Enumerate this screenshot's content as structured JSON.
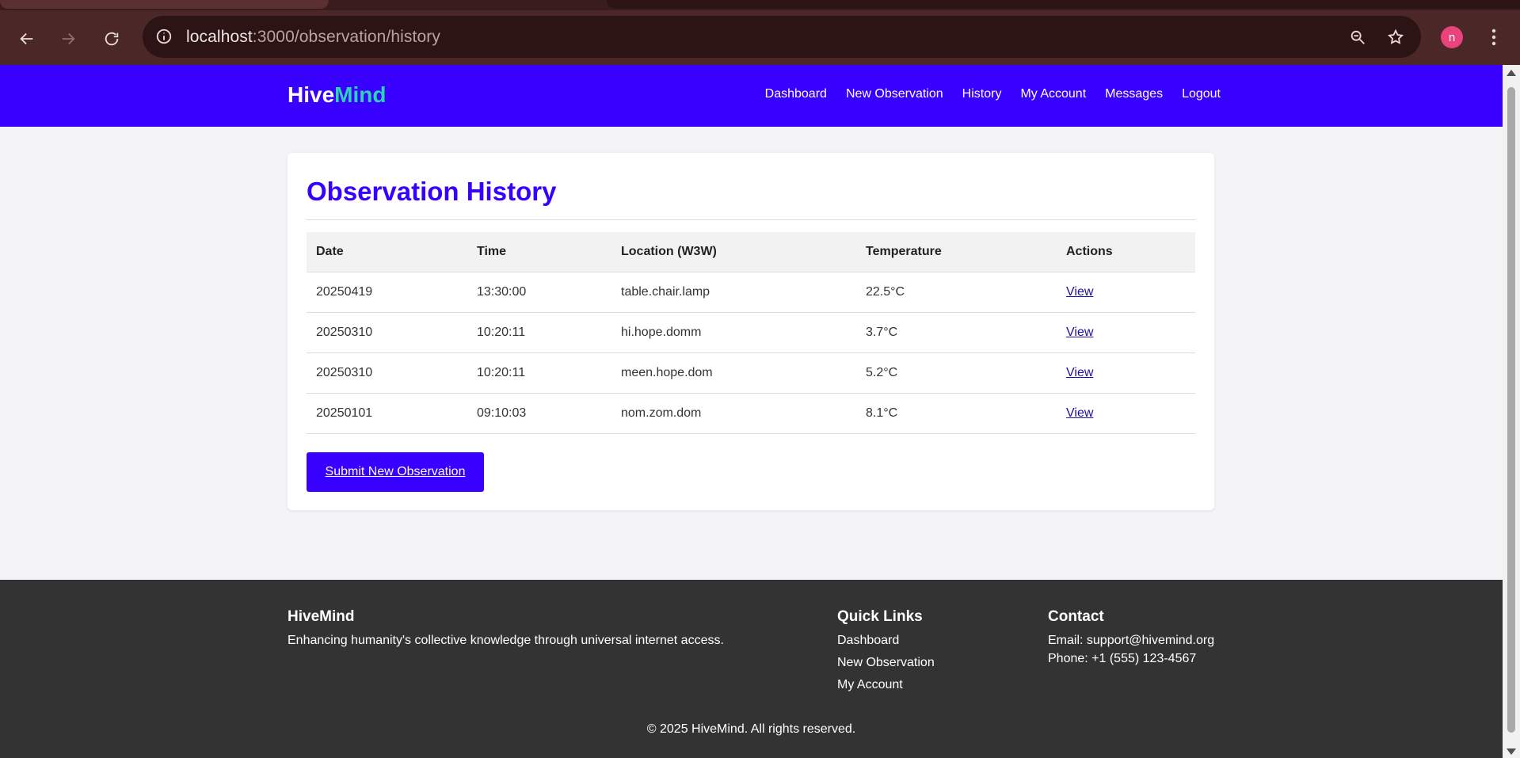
{
  "browser": {
    "url_host": "localhost",
    "url_path": ":3000/observation/history",
    "profile_initial": "n"
  },
  "header": {
    "logo_main": "Hive",
    "logo_accent": "Mind",
    "nav": [
      "Dashboard",
      "New Observation",
      "History",
      "My Account",
      "Messages",
      "Logout"
    ]
  },
  "main": {
    "title": "Observation History",
    "columns": [
      "Date",
      "Time",
      "Location (W3W)",
      "Temperature",
      "Actions"
    ],
    "rows": [
      {
        "date": "20250419",
        "time": "13:30:00",
        "location": "table.chair.lamp",
        "temperature": "22.5°C",
        "action": "View"
      },
      {
        "date": "20250310",
        "time": "10:20:11",
        "location": "hi.hope.domm",
        "temperature": "3.7°C",
        "action": "View"
      },
      {
        "date": "20250310",
        "time": "10:20:11",
        "location": "meen.hope.dom",
        "temperature": "5.2°C",
        "action": "View"
      },
      {
        "date": "20250101",
        "time": "09:10:03",
        "location": "nom.zom.dom",
        "temperature": "8.1°C",
        "action": "View"
      }
    ],
    "submit_label": "Submit New Observation"
  },
  "footer": {
    "brand_title": "HiveMind",
    "brand_text": "Enhancing humanity's collective knowledge through universal internet access.",
    "links_title": "Quick Links",
    "links": [
      "Dashboard",
      "New Observation",
      "My Account"
    ],
    "contact_title": "Contact",
    "email": "Email: support@hivemind.org",
    "phone": "Phone: +1 (555) 123-4567",
    "copyright": "© 2025 HiveMind. All rights reserved."
  },
  "colors": {
    "header_bg": "#3700ff",
    "logo_accent": "#2ed3b7",
    "footer_bg": "#343334",
    "chrome_bg": "#4b2727"
  }
}
